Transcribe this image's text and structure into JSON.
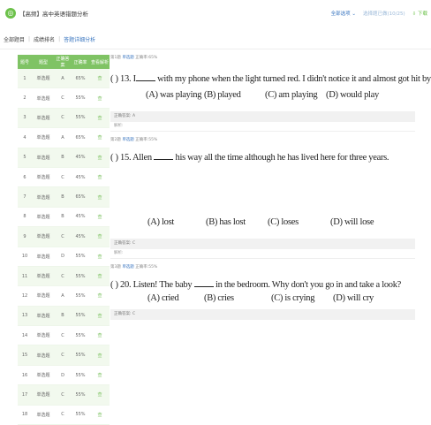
{
  "header": {
    "logo_glyph": "◎",
    "title": "【高频】高中英语错题分析",
    "select_label": "全部选项 ⌄",
    "setting_label": "选择题已做(10/25)",
    "export_label": "⇩ 下载"
  },
  "tabs": [
    {
      "label": "全部题目"
    },
    {
      "label": "成绩排名"
    },
    {
      "label": "答题详细分析"
    }
  ],
  "table": {
    "headers": [
      "题号",
      "题型",
      "正确答案",
      "正确率",
      "查看解析"
    ],
    "rows": [
      [
        "1",
        "单选题",
        "A",
        "65%",
        "查"
      ],
      [
        "2",
        "单选题",
        "C",
        "55%",
        "查"
      ],
      [
        "3",
        "单选题",
        "C",
        "55%",
        "查"
      ],
      [
        "4",
        "单选题",
        "A",
        "65%",
        "查"
      ],
      [
        "5",
        "单选题",
        "B",
        "45%",
        "查"
      ],
      [
        "6",
        "单选题",
        "C",
        "45%",
        "查"
      ],
      [
        "7",
        "单选题",
        "B",
        "65%",
        "查"
      ],
      [
        "8",
        "单选题",
        "B",
        "45%",
        "查"
      ],
      [
        "9",
        "单选题",
        "C",
        "45%",
        "查"
      ],
      [
        "10",
        "单选题",
        "D",
        "55%",
        "查"
      ],
      [
        "11",
        "单选题",
        "C",
        "55%",
        "查"
      ],
      [
        "12",
        "单选题",
        "A",
        "55%",
        "查"
      ],
      [
        "13",
        "单选题",
        "B",
        "55%",
        "查"
      ],
      [
        "14",
        "单选题",
        "C",
        "55%",
        "查"
      ],
      [
        "15",
        "单选题",
        "C",
        "55%",
        "查"
      ],
      [
        "16",
        "单选题",
        "D",
        "55%",
        "查"
      ],
      [
        "17",
        "单选题",
        "C",
        "55%",
        "查"
      ],
      [
        "18",
        "单选题",
        "C",
        "55%",
        "查"
      ]
    ]
  },
  "questions": [
    {
      "meta_num": "第1题",
      "meta_type": "单选题",
      "meta_rate": "正确率:65%",
      "stem_pre": "(    ) 13. I",
      "stem_post": " with my phone when the light turned red. I didn't notice it and almost got hit by a car.",
      "options": [
        "(A) was playing",
        "(B) played",
        "(C) am playing",
        "(D) would play"
      ],
      "answer": "正确答案: A",
      "analysis": "解析:"
    },
    {
      "meta_num": "第2题",
      "meta_type": "单选题",
      "meta_rate": "正确率:55%",
      "stem_pre": "(    ) 15. Allen ",
      "stem_post": " his way all the time although he has lived here for three years.",
      "options": [
        "(A) lost",
        "(B) has lost",
        "(C) loses",
        "(D) will lose"
      ],
      "answer": "正确答案: C",
      "analysis": "解析:"
    },
    {
      "meta_num": "第3题",
      "meta_type": "单选题",
      "meta_rate": "正确率:55%",
      "stem_pre": "(    ) 20. Listen! The baby ",
      "stem_post": " in the bedroom. Why don't you go in and take a look?",
      "options": [
        "(A) cried",
        "(B) cries",
        "(C) is crying",
        "(D) will cry"
      ],
      "answer": "正确答案: C",
      "analysis": ""
    }
  ]
}
